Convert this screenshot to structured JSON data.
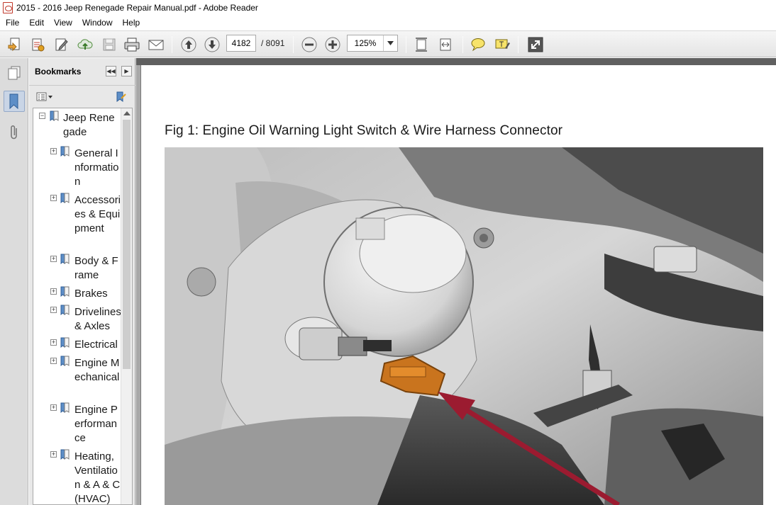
{
  "window": {
    "title": "2015 - 2016 Jeep Renegade Repair Manual.pdf - Adobe Reader"
  },
  "menu": [
    "File",
    "Edit",
    "View",
    "Window",
    "Help"
  ],
  "toolbar": {
    "page_current": "4182",
    "page_total": "/ 8091",
    "zoom": "125%",
    "icons": [
      "create-pdf-icon",
      "edit-pdf-icon",
      "sign-icon",
      "cloud-upload-icon",
      "save-icon",
      "print-icon",
      "email-icon",
      "previous-page-icon",
      "next-page-icon",
      "zoom-out-icon",
      "zoom-in-icon",
      "fit-page-icon",
      "fit-width-icon",
      "comment-icon",
      "highlight-icon",
      "fullscreen-icon"
    ]
  },
  "bookmarks": {
    "title": "Bookmarks",
    "root": "Jeep Renegade",
    "items": [
      {
        "label": "General Information"
      },
      {
        "label": "Accessories & Equipment"
      },
      {
        "label": "Body & Frame"
      },
      {
        "label": "Brakes"
      },
      {
        "label": "Drivelines & Axles"
      },
      {
        "label": "Electrical"
      },
      {
        "label": "Engine Mechanical"
      },
      {
        "label": "Engine Performance"
      },
      {
        "label": "Heating, Ventilation & A & C (HVAC)"
      }
    ]
  },
  "document": {
    "figure_caption": "Fig 1: Engine Oil Warning Light Switch & Wire Harness Connector"
  },
  "colors": {
    "connector": "#c9741e",
    "arrow": "#9b1b30",
    "panel_bg": "#e8e8e8"
  }
}
